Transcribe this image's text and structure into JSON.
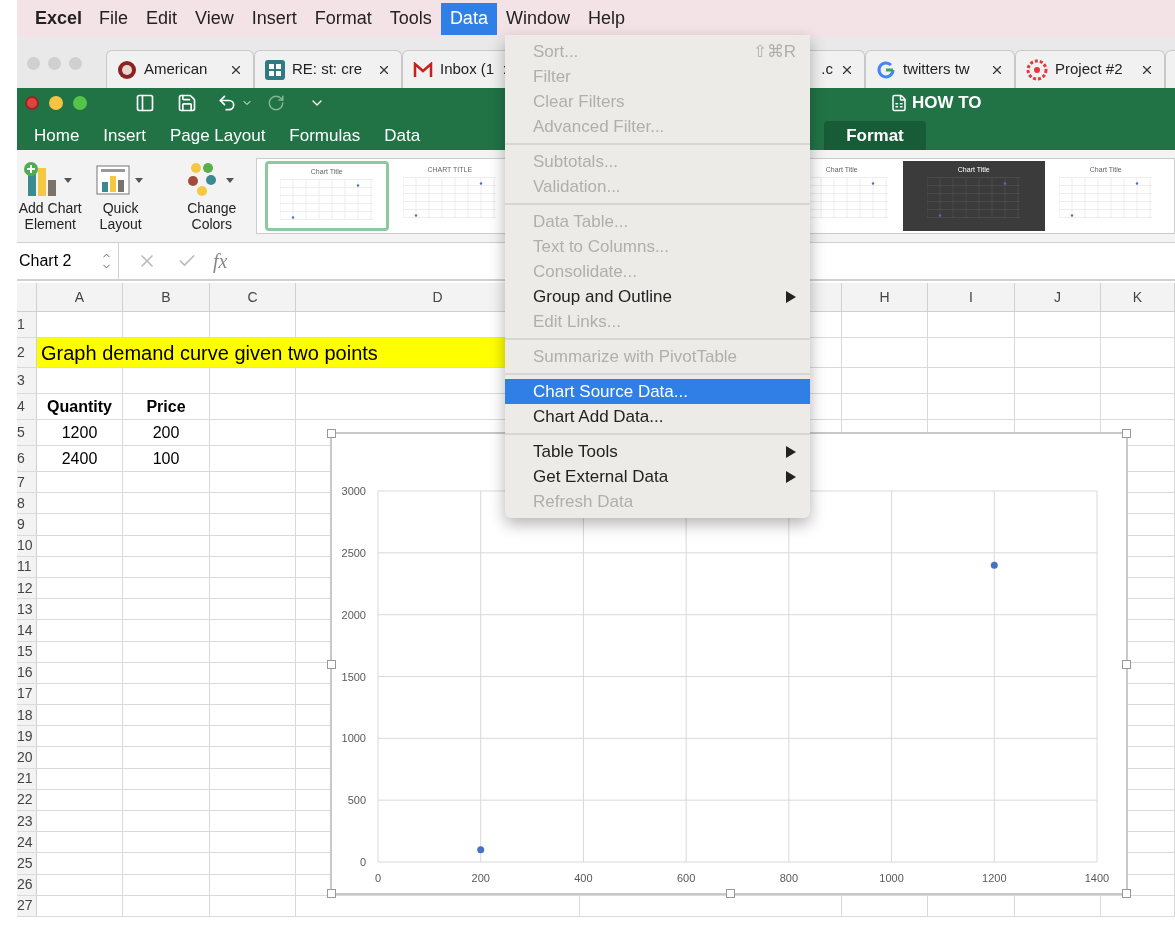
{
  "menubar": {
    "app": "Excel",
    "items": [
      {
        "label": "File",
        "selected": false
      },
      {
        "label": "Edit",
        "selected": false
      },
      {
        "label": "View",
        "selected": false
      },
      {
        "label": "Insert",
        "selected": false
      },
      {
        "label": "Format",
        "selected": false
      },
      {
        "label": "Tools",
        "selected": false
      },
      {
        "label": "Data",
        "selected": true
      },
      {
        "label": "Window",
        "selected": false
      },
      {
        "label": "Help",
        "selected": false
      }
    ]
  },
  "browser": {
    "tabs": [
      {
        "title": "American"
      },
      {
        "title": "RE: st: cre"
      },
      {
        "title": "Inbox (1"
      },
      {
        "title": ".c"
      },
      {
        "title": "twitters tw"
      },
      {
        "title": "Project #2"
      }
    ]
  },
  "workbook": {
    "title": "HOW TO"
  },
  "ribbon": {
    "tabs": [
      {
        "label": "Home",
        "selected": false
      },
      {
        "label": "Insert",
        "selected": false
      },
      {
        "label": "Page Layout",
        "selected": false
      },
      {
        "label": "Formulas",
        "selected": false
      },
      {
        "label": "Data",
        "selected": false
      },
      {
        "label": "Format",
        "selected": true
      }
    ],
    "buttons": [
      {
        "label": "Add Chart Element"
      },
      {
        "label": "Quick Layout"
      },
      {
        "label": "Change Colors"
      }
    ],
    "styles": [
      {
        "title": "Chart Title",
        "dark": false,
        "selected": true
      },
      {
        "title": "CHART TITLE",
        "dark": false,
        "selected": false
      },
      {
        "title": "Chart Title",
        "dark": false,
        "selected": false
      },
      {
        "title": "Chart Title",
        "dark": true,
        "selected": false
      },
      {
        "title": "Chart Title",
        "dark": false,
        "selected": false
      }
    ]
  },
  "formula_bar": {
    "name_box": "Chart 2",
    "fx": "fx"
  },
  "sheet": {
    "columns": [
      "A",
      "B",
      "C",
      "D",
      "",
      "H",
      "I",
      "J",
      "K"
    ],
    "rows": [
      {
        "number": "1",
        "kind": "empty"
      },
      {
        "number": "2",
        "kind": "title",
        "text": "Graph demand curve given two points"
      },
      {
        "number": "3",
        "kind": "empty"
      },
      {
        "number": "4",
        "kind": "header",
        "cells": [
          "Quantity",
          "Price"
        ]
      },
      {
        "number": "5",
        "kind": "data",
        "cells": [
          "1200",
          "200"
        ]
      },
      {
        "number": "6",
        "kind": "data",
        "cells": [
          "2400",
          "100"
        ]
      },
      {
        "number": "7",
        "kind": "empty"
      },
      {
        "number": "8",
        "kind": "empty"
      },
      {
        "number": "9",
        "kind": "empty"
      },
      {
        "number": "10",
        "kind": "empty"
      },
      {
        "number": "11",
        "kind": "empty"
      },
      {
        "number": "12",
        "kind": "empty"
      },
      {
        "number": "13",
        "kind": "empty"
      },
      {
        "number": "14",
        "kind": "empty"
      },
      {
        "number": "15",
        "kind": "empty"
      },
      {
        "number": "16",
        "kind": "empty"
      },
      {
        "number": "17",
        "kind": "empty"
      },
      {
        "number": "18",
        "kind": "empty"
      },
      {
        "number": "19",
        "kind": "empty"
      },
      {
        "number": "20",
        "kind": "empty"
      },
      {
        "number": "21",
        "kind": "empty"
      },
      {
        "number": "22",
        "kind": "empty"
      },
      {
        "number": "23",
        "kind": "empty"
      },
      {
        "number": "24",
        "kind": "empty"
      },
      {
        "number": "25",
        "kind": "empty"
      },
      {
        "number": "26",
        "kind": "empty"
      },
      {
        "number": "27",
        "kind": "empty"
      }
    ]
  },
  "chart": {
    "chart_data": {
      "type": "scatter",
      "x": [
        200,
        1200
      ],
      "series": [
        {
          "color": "#4472c4",
          "values": [
            100,
            2400
          ]
        }
      ],
      "grid": true,
      "xlim": [
        0,
        1400
      ],
      "ylim": [
        0,
        3000
      ],
      "xticks": [
        0,
        200,
        400,
        600,
        800,
        1000,
        1200,
        1400
      ],
      "yticks": [
        0,
        500,
        1000,
        1500,
        2000,
        2500,
        3000
      ]
    }
  },
  "menu": {
    "groups": [
      [
        {
          "label": "Sort...",
          "shortcut": "⇧⌘R",
          "disabled": true,
          "selected": false,
          "submenu": false
        },
        {
          "label": "Filter",
          "disabled": true,
          "selected": false,
          "submenu": false
        },
        {
          "label": "Clear Filters",
          "disabled": true,
          "selected": false,
          "submenu": false
        },
        {
          "label": "Advanced Filter...",
          "disabled": true,
          "selected": false,
          "submenu": false
        }
      ],
      [
        {
          "label": "Subtotals...",
          "disabled": true,
          "selected": false,
          "submenu": false
        },
        {
          "label": "Validation...",
          "disabled": true,
          "selected": false,
          "submenu": false
        }
      ],
      [
        {
          "label": "Data Table...",
          "disabled": true,
          "selected": false,
          "submenu": false
        },
        {
          "label": "Text to Columns...",
          "disabled": true,
          "selected": false,
          "submenu": false
        },
        {
          "label": "Consolidate...",
          "disabled": true,
          "selected": false,
          "submenu": false
        },
        {
          "label": "Group and Outline",
          "disabled": false,
          "selected": false,
          "submenu": true
        },
        {
          "label": "Edit Links...",
          "disabled": true,
          "selected": false,
          "submenu": false
        }
      ],
      [
        {
          "label": "Summarize with PivotTable",
          "disabled": true,
          "selected": false,
          "submenu": false
        }
      ],
      [
        {
          "label": "Chart Source Data...",
          "disabled": false,
          "selected": true,
          "submenu": false
        },
        {
          "label": "Chart Add Data...",
          "disabled": false,
          "selected": false,
          "submenu": false
        }
      ],
      [
        {
          "label": "Table Tools",
          "disabled": false,
          "selected": false,
          "submenu": true
        },
        {
          "label": "Get External Data",
          "disabled": false,
          "selected": false,
          "submenu": true
        },
        {
          "label": "Refresh Data",
          "disabled": true,
          "selected": false,
          "submenu": false
        }
      ]
    ]
  }
}
